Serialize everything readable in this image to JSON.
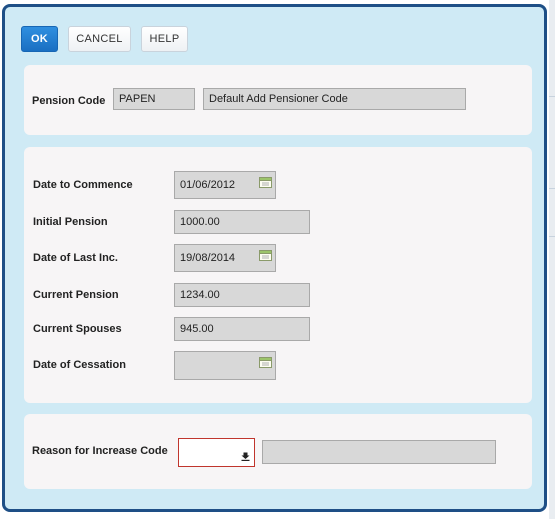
{
  "toolbar": {
    "ok_label": "OK",
    "cancel_label": "CANCEL",
    "help_label": "HELP"
  },
  "pension": {
    "label": "Pension Code",
    "code": "PAPEN",
    "description": "Default Add Pensioner Code"
  },
  "details": {
    "date_to_commence": {
      "label": "Date to Commence",
      "value": "01/06/2012"
    },
    "initial_pension": {
      "label": "Initial Pension",
      "value": "1000.00"
    },
    "date_of_last_inc": {
      "label": "Date of Last Inc.",
      "value": "19/08/2014"
    },
    "current_pension": {
      "label": "Current Pension",
      "value": "1234.00"
    },
    "current_spouses": {
      "label": "Current Spouses",
      "value": "945.00"
    },
    "date_of_cessation": {
      "label": "Date of Cessation",
      "value": ""
    }
  },
  "reason": {
    "label": "Reason for Increase Code",
    "selected": "",
    "description": ""
  },
  "icons": {
    "calendar": "calendar-icon",
    "dropdown": "download-arrow-icon"
  },
  "colors": {
    "dialog_border": "#1e4f86",
    "dialog_background": "#cfeaf5",
    "primary_button": "#1a6fc2",
    "invalid_border": "#c0352d"
  }
}
